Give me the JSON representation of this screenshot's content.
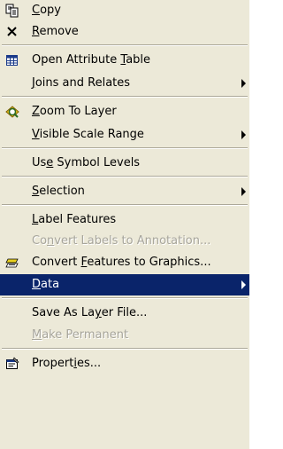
{
  "menu": {
    "items": [
      {
        "key": "copy",
        "pre": "",
        "u": "C",
        "post": "opy",
        "icon": "copy-icon"
      },
      {
        "key": "remove",
        "pre": "",
        "u": "R",
        "post": "emove",
        "icon": "remove-icon"
      },
      {
        "key": "open-attribute-table",
        "pre": "Open Attribute ",
        "u": "T",
        "post": "able",
        "icon": "attribute-table-icon"
      },
      {
        "key": "joins-and-relates",
        "pre": "",
        "u": "J",
        "post": "oins and Relates",
        "submenu": true
      },
      {
        "key": "zoom-to-layer",
        "pre": "",
        "u": "Z",
        "post": "oom To Layer",
        "icon": "zoom-to-layer-icon"
      },
      {
        "key": "visible-scale-range",
        "pre": "",
        "u": "V",
        "post": "isible Scale Range",
        "submenu": true
      },
      {
        "key": "use-symbol-levels",
        "pre": "Us",
        "u": "e",
        "post": " Symbol Levels"
      },
      {
        "key": "selection",
        "pre": "",
        "u": "S",
        "post": "election",
        "submenu": true
      },
      {
        "key": "label-features",
        "pre": "",
        "u": "L",
        "post": "abel Features"
      },
      {
        "key": "convert-labels-to-annotation",
        "pre": "Co",
        "u": "n",
        "post": "vert Labels to Annotation...",
        "disabled": true
      },
      {
        "key": "convert-features-to-graphics",
        "pre": "Convert ",
        "u": "F",
        "post": "eatures to Graphics...",
        "icon": "convert-graphics-icon"
      },
      {
        "key": "data",
        "pre": "",
        "u": "D",
        "post": "ata",
        "submenu": true,
        "selected": true
      },
      {
        "key": "save-as-layer-file",
        "pre": "Save As La",
        "u": "y",
        "post": "er File..."
      },
      {
        "key": "make-permanent",
        "pre": "",
        "u": "M",
        "post": "ake Permanent",
        "disabled": true
      },
      {
        "key": "properties",
        "pre": "Propert",
        "u": "i",
        "post": "es...",
        "icon": "properties-icon"
      }
    ]
  },
  "colors": {
    "menu_background": "#ece9d8",
    "selection_background": "#0a246a",
    "disabled_text": "#a7a59b",
    "separator": "#aca899"
  }
}
